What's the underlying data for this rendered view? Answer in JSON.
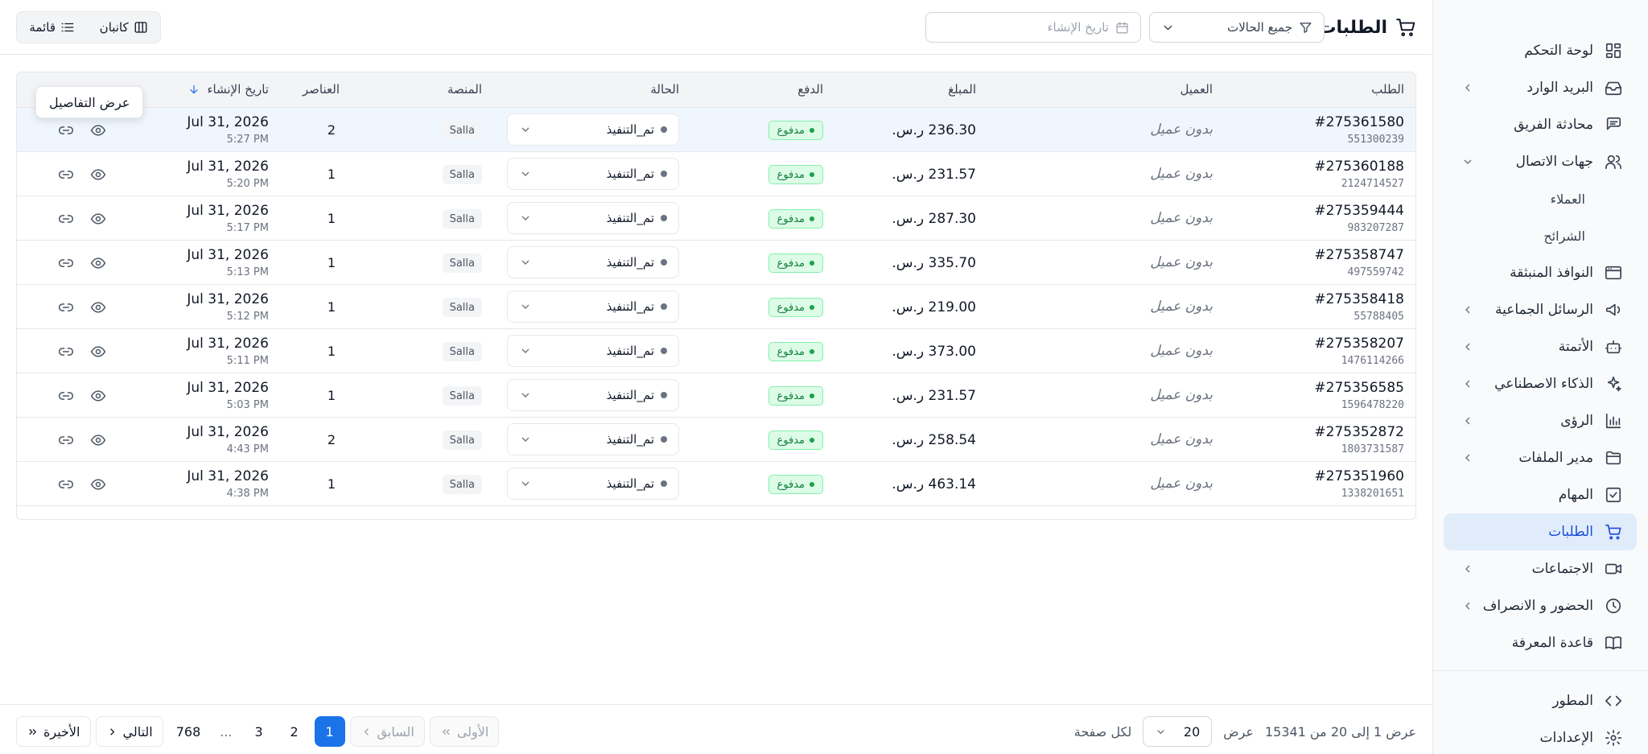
{
  "sidebar": {
    "items": [
      {
        "label": "لوحة التحكم",
        "icon": "dashboard-icon",
        "chevron": false
      },
      {
        "label": "البريد الوارد",
        "icon": "inbox-icon",
        "chevron": true
      },
      {
        "label": "محادثة الفريق",
        "icon": "chat-icon",
        "chevron": false
      },
      {
        "label": "جهات الاتصال",
        "icon": "users-icon",
        "chevron": true,
        "expanded": true
      },
      {
        "label": "العملاء",
        "sub": true
      },
      {
        "label": "الشرائح",
        "sub": true
      },
      {
        "label": "النوافذ المنبثقة",
        "icon": "window-icon",
        "chevron": false
      },
      {
        "label": "الرسائل الجماعية",
        "icon": "megaphone-icon",
        "chevron": true
      },
      {
        "label": "الأتمتة",
        "icon": "bot-icon",
        "chevron": true
      },
      {
        "label": "الذكاء الاصطناعي",
        "icon": "sparkles-icon",
        "chevron": true
      },
      {
        "label": "الرؤى",
        "icon": "bar-chart-icon",
        "chevron": true
      },
      {
        "label": "مدير الملفات",
        "icon": "folder-icon",
        "chevron": true
      },
      {
        "label": "المهام",
        "icon": "tasks-icon",
        "chevron": false
      },
      {
        "label": "الطلبات",
        "icon": "cart-icon",
        "chevron": false,
        "active": true
      },
      {
        "label": "الاجتماعات",
        "icon": "video-icon",
        "chevron": true
      },
      {
        "label": "الحضور و الانصراف",
        "icon": "clock-icon",
        "chevron": true
      },
      {
        "label": "قاعدة المعرفة",
        "icon": "book-icon",
        "chevron": false
      }
    ],
    "bottom": [
      {
        "label": "المطور",
        "icon": "code-icon"
      },
      {
        "label": "الإعدادات",
        "icon": "settings-icon"
      }
    ]
  },
  "header": {
    "title": "الطلبات",
    "status_filter": "جميع الحالات",
    "date_filter_placeholder": "تاريخ الإنشاء",
    "view_kanban": "كانبان",
    "view_list": "قائمة"
  },
  "table": {
    "columns": {
      "order": "الطلب",
      "customer": "العميل",
      "amount": "المبلغ",
      "payment": "الدفع",
      "status": "الحالة",
      "platform": "المنصة",
      "items": "العناصر",
      "created": "تاريخ الإنشاء"
    },
    "rows": [
      {
        "order": "#275361580",
        "sub": "551300239",
        "customer": "بدون عميل",
        "amount": "236.30 ر.س.",
        "payment": "مدفوع",
        "status": "تم_التنفيذ",
        "platform": "Salla",
        "items": "2",
        "date": "Jul 31, 2026",
        "time": "5:27 PM"
      },
      {
        "order": "#275360188",
        "sub": "2124714527",
        "customer": "بدون عميل",
        "amount": "231.57 ر.س.",
        "payment": "مدفوع",
        "status": "تم_التنفيذ",
        "platform": "Salla",
        "items": "1",
        "date": "Jul 31, 2026",
        "time": "5:20 PM"
      },
      {
        "order": "#275359444",
        "sub": "983207287",
        "customer": "بدون عميل",
        "amount": "287.30 ر.س.",
        "payment": "مدفوع",
        "status": "تم_التنفيذ",
        "platform": "Salla",
        "items": "1",
        "date": "Jul 31, 2026",
        "time": "5:17 PM"
      },
      {
        "order": "#275358747",
        "sub": "497559742",
        "customer": "بدون عميل",
        "amount": "335.70 ر.س.",
        "payment": "مدفوع",
        "status": "تم_التنفيذ",
        "platform": "Salla",
        "items": "1",
        "date": "Jul 31, 2026",
        "time": "5:13 PM"
      },
      {
        "order": "#275358418",
        "sub": "55788405",
        "customer": "بدون عميل",
        "amount": "219.00 ر.س.",
        "payment": "مدفوع",
        "status": "تم_التنفيذ",
        "platform": "Salla",
        "items": "1",
        "date": "Jul 31, 2026",
        "time": "5:12 PM"
      },
      {
        "order": "#275358207",
        "sub": "1476114266",
        "customer": "بدون عميل",
        "amount": "373.00 ر.س.",
        "payment": "مدفوع",
        "status": "تم_التنفيذ",
        "platform": "Salla",
        "items": "1",
        "date": "Jul 31, 2026",
        "time": "5:11 PM"
      },
      {
        "order": "#275356585",
        "sub": "1596478220",
        "customer": "بدون عميل",
        "amount": "231.57 ر.س.",
        "payment": "مدفوع",
        "status": "تم_التنفيذ",
        "platform": "Salla",
        "items": "1",
        "date": "Jul 31, 2026",
        "time": "5:03 PM"
      },
      {
        "order": "#275352872",
        "sub": "1803731587",
        "customer": "بدون عميل",
        "amount": "258.54 ر.س.",
        "payment": "مدفوع",
        "status": "تم_التنفيذ",
        "platform": "Salla",
        "items": "2",
        "date": "Jul 31, 2026",
        "time": "4:43 PM"
      },
      {
        "order": "#275351960",
        "sub": "1338201651",
        "customer": "بدون عميل",
        "amount": "463.14 ر.س.",
        "payment": "مدفوع",
        "status": "تم_التنفيذ",
        "platform": "Salla",
        "items": "1",
        "date": "Jul 31, 2026",
        "time": "4:38 PM"
      }
    ],
    "tooltip": "عرض التفاصيل"
  },
  "footer": {
    "showing": "عرض 1 إلى 20 من 15341",
    "show_label": "عرض",
    "page_size": "20",
    "per_page": "لكل صفحة",
    "first": "الأولى",
    "prev": "السابق",
    "pages": [
      "1",
      "2",
      "3"
    ],
    "ellipsis": "...",
    "last_page": "768",
    "next": "التالي",
    "last": "الأخيرة",
    "current_page": "1"
  },
  "colors": {
    "accent": "#1a73e8",
    "active_nav_bg": "#e1ecfb",
    "paid_badge": "#dcfce7"
  }
}
